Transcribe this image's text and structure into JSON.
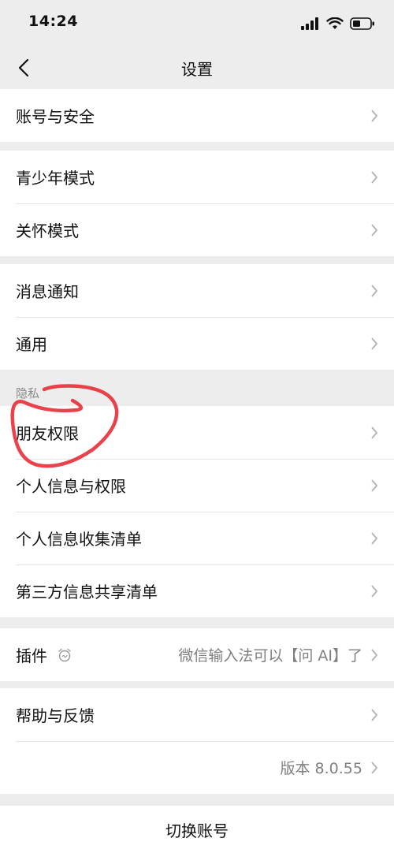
{
  "status_bar": {
    "time": "14:24"
  },
  "nav": {
    "title": "设置"
  },
  "groups": {
    "account": [
      "账号与安全"
    ],
    "modes": [
      "青少年模式",
      "关怀模式"
    ],
    "general": [
      "消息通知",
      "通用"
    ],
    "privacy_header": "隐私",
    "privacy": [
      "朋友权限",
      "个人信息与权限",
      "个人信息收集清单",
      "第三方信息共享清单"
    ],
    "plugin": {
      "label": "插件",
      "value": "微信输入法可以【问 AI】了",
      "icon": "alarm-clock-icon"
    },
    "help": {
      "label": "帮助与反馈",
      "version": "版本 8.0.55"
    }
  },
  "switch_account": "切换账号",
  "colors": {
    "background": "#ededed",
    "cell": "#ffffff",
    "annotation": "#e8323c",
    "secondary_text": "#7f7f7f"
  }
}
